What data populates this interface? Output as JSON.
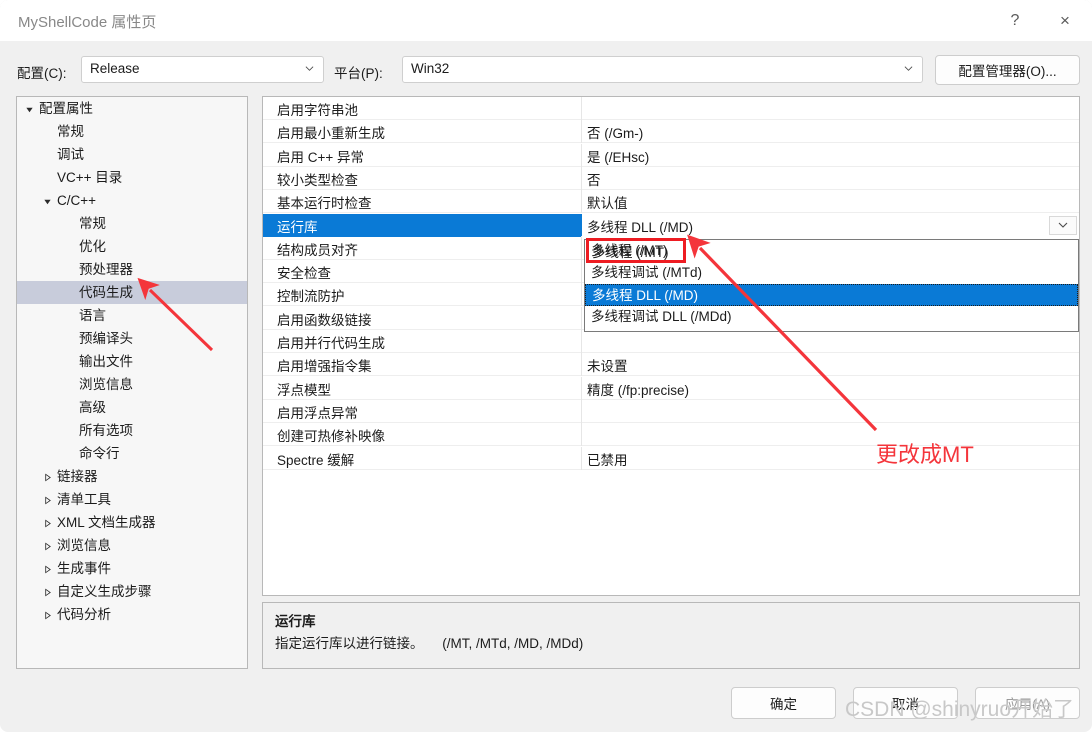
{
  "window": {
    "title": "MyShellCode 属性页",
    "help_icon": "?",
    "close_icon": "×"
  },
  "toolbar": {
    "config_label": "配置(C):",
    "config_value": "Release",
    "platform_label": "平台(P):",
    "platform_value": "Win32",
    "config_manager_button": "配置管理器(O)..."
  },
  "tree": {
    "items": [
      {
        "label": "配置属性",
        "indent": 0,
        "twisty": "open",
        "selected": false
      },
      {
        "label": "常规",
        "indent": 1,
        "twisty": "none",
        "selected": false
      },
      {
        "label": "调试",
        "indent": 1,
        "twisty": "none",
        "selected": false
      },
      {
        "label": "VC++ 目录",
        "indent": 1,
        "twisty": "none",
        "selected": false
      },
      {
        "label": "C/C++",
        "indent": 1,
        "twisty": "open",
        "selected": false
      },
      {
        "label": "常规",
        "indent": 2,
        "twisty": "none",
        "selected": false
      },
      {
        "label": "优化",
        "indent": 2,
        "twisty": "none",
        "selected": false
      },
      {
        "label": "预处理器",
        "indent": 2,
        "twisty": "none",
        "selected": false
      },
      {
        "label": "代码生成",
        "indent": 2,
        "twisty": "none",
        "selected": true
      },
      {
        "label": "语言",
        "indent": 2,
        "twisty": "none",
        "selected": false
      },
      {
        "label": "预编译头",
        "indent": 2,
        "twisty": "none",
        "selected": false
      },
      {
        "label": "输出文件",
        "indent": 2,
        "twisty": "none",
        "selected": false
      },
      {
        "label": "浏览信息",
        "indent": 2,
        "twisty": "none",
        "selected": false
      },
      {
        "label": "高级",
        "indent": 2,
        "twisty": "none",
        "selected": false
      },
      {
        "label": "所有选项",
        "indent": 2,
        "twisty": "none",
        "selected": false
      },
      {
        "label": "命令行",
        "indent": 2,
        "twisty": "none",
        "selected": false
      },
      {
        "label": "链接器",
        "indent": 1,
        "twisty": "closed",
        "selected": false
      },
      {
        "label": "清单工具",
        "indent": 1,
        "twisty": "closed",
        "selected": false
      },
      {
        "label": "XML 文档生成器",
        "indent": 1,
        "twisty": "closed",
        "selected": false
      },
      {
        "label": "浏览信息",
        "indent": 1,
        "twisty": "closed",
        "selected": false
      },
      {
        "label": "生成事件",
        "indent": 1,
        "twisty": "closed",
        "selected": false
      },
      {
        "label": "自定义生成步骤",
        "indent": 1,
        "twisty": "closed",
        "selected": false
      },
      {
        "label": "代码分析",
        "indent": 1,
        "twisty": "closed",
        "selected": false
      }
    ]
  },
  "grid": {
    "rows": [
      {
        "name": "启用字符串池",
        "value": "",
        "selected": false
      },
      {
        "name": "启用最小重新生成",
        "value": "否 (/Gm-)",
        "selected": false
      },
      {
        "name": "启用 C++ 异常",
        "value": "是 (/EHsc)",
        "selected": false
      },
      {
        "name": "较小类型检查",
        "value": "否",
        "selected": false
      },
      {
        "name": "基本运行时检查",
        "value": "默认值",
        "selected": false
      },
      {
        "name": "运行库",
        "value": "多线程 DLL (/MD)",
        "selected": true
      },
      {
        "name": "结构成员对齐",
        "value": "",
        "selected": false
      },
      {
        "name": "安全检查",
        "value": "",
        "selected": false
      },
      {
        "name": "控制流防护",
        "value": "",
        "selected": false
      },
      {
        "name": "启用函数级链接",
        "value": "",
        "selected": false
      },
      {
        "name": "启用并行代码生成",
        "value": "",
        "selected": false
      },
      {
        "name": "启用增强指令集",
        "value": "未设置",
        "selected": false
      },
      {
        "name": "浮点模型",
        "value": "精度 (/fp:precise)",
        "selected": false
      },
      {
        "name": "启用浮点异常",
        "value": "",
        "selected": false
      },
      {
        "name": "创建可热修补映像",
        "value": "",
        "selected": false
      },
      {
        "name": "Spectre 缓解",
        "value": "已禁用",
        "selected": false
      }
    ]
  },
  "dropdown": {
    "options": [
      {
        "label": "多线程 (/MT)",
        "highlighted": false
      },
      {
        "label": "多线程调试 (/MTd)",
        "highlighted": false
      },
      {
        "label": "多线程 DLL (/MD)",
        "highlighted": true
      },
      {
        "label": "多线程调试 DLL (/MDd)",
        "highlighted": false
      }
    ],
    "boxed_option": "多线程 (/MT)"
  },
  "description": {
    "title": "运行库",
    "body": "指定运行库以进行链接。     (/MT, /MTd, /MD, /MDd)"
  },
  "footer": {
    "ok": "确定",
    "cancel": "取消",
    "apply": "应用(A)"
  },
  "annotations": {
    "note_text": "更改成MT",
    "note_color": "#f4353b",
    "watermark": "CSDN @shinyruo开始了"
  }
}
